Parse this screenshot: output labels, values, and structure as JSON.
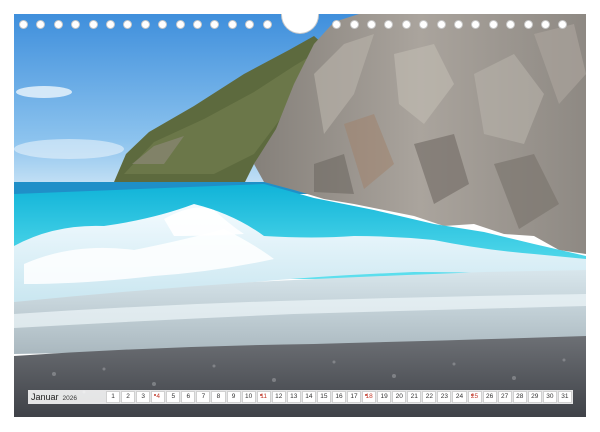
{
  "calendar": {
    "month": "Januar",
    "year": "2026",
    "days": [
      {
        "n": "1",
        "sun": false
      },
      {
        "n": "2",
        "sun": false
      },
      {
        "n": "3",
        "sun": false
      },
      {
        "n": "4",
        "sun": true
      },
      {
        "n": "5",
        "sun": false
      },
      {
        "n": "6",
        "sun": false
      },
      {
        "n": "7",
        "sun": false
      },
      {
        "n": "8",
        "sun": false
      },
      {
        "n": "9",
        "sun": false
      },
      {
        "n": "10",
        "sun": false
      },
      {
        "n": "11",
        "sun": true
      },
      {
        "n": "12",
        "sun": false
      },
      {
        "n": "13",
        "sun": false
      },
      {
        "n": "14",
        "sun": false
      },
      {
        "n": "15",
        "sun": false
      },
      {
        "n": "16",
        "sun": false
      },
      {
        "n": "17",
        "sun": false
      },
      {
        "n": "18",
        "sun": true
      },
      {
        "n": "19",
        "sun": false
      },
      {
        "n": "20",
        "sun": false
      },
      {
        "n": "21",
        "sun": false
      },
      {
        "n": "22",
        "sun": false
      },
      {
        "n": "23",
        "sun": false
      },
      {
        "n": "24",
        "sun": false
      },
      {
        "n": "25",
        "sun": true
      },
      {
        "n": "26",
        "sun": false
      },
      {
        "n": "27",
        "sun": false
      },
      {
        "n": "28",
        "sun": false
      },
      {
        "n": "29",
        "sun": false
      },
      {
        "n": "30",
        "sun": false
      },
      {
        "n": "31",
        "sun": false
      }
    ]
  },
  "colors": {
    "sunday": "#c0392b",
    "sky": "#5aa9e6",
    "sea": "#1fc4e0",
    "rock": "#9a9590"
  }
}
